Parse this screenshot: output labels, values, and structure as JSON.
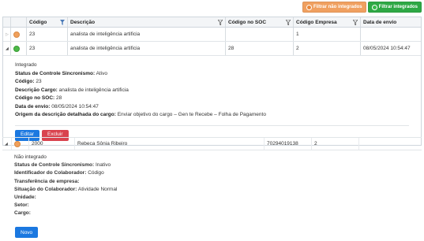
{
  "toolbar": {
    "filter_not_integrated": "Filtrar não integrados",
    "filter_integrated": "Filtrar integrados"
  },
  "grid": {
    "columns": [
      "Código",
      "Descrição",
      "Código no SOC",
      "Código Empresa",
      "Data de envio"
    ],
    "rows": [
      {
        "status": "orange",
        "codigo": "23",
        "descricao": "analista de inteligência artificia",
        "codigo_soc": "",
        "codigo_empresa": "1",
        "data_envio": ""
      },
      {
        "status": "green",
        "codigo": "23",
        "descricao": "analista de inteligência artificia",
        "codigo_soc": "28",
        "codigo_empresa": "2",
        "data_envio": "08/05/2024 10:54:47"
      }
    ]
  },
  "detail1": {
    "title": "Integrado",
    "lines": [
      {
        "label": "Status de Controle Sincronismo:",
        "value": "Ativo"
      },
      {
        "label": "Código:",
        "value": "23"
      },
      {
        "label": "Descrição Cargo:",
        "value": "analista de inteligência artificia"
      },
      {
        "label": "Código no SOC:",
        "value": "28"
      },
      {
        "label": "Data de envio:",
        "value": "08/05/2024 10:54:47"
      },
      {
        "label": "Origem da descrição detalhada do cargo:",
        "value": "Enviar objetivo do cargo – Gen te Recebe – Folha de Pagamento"
      }
    ],
    "edit_label": "Editar",
    "delete_label": "Excluir"
  },
  "row3": {
    "status": "orange",
    "codigo": "2000",
    "nome": "Rebeca Sônia Ribeiro",
    "cpf": "70294019138",
    "empresa": "2"
  },
  "detail2": {
    "title": "Não integrado",
    "lines": [
      {
        "label": "Status de Controle Sincronismo:",
        "value": "Inativo"
      },
      {
        "label": "Identificador do Colaborador:",
        "value": "Código"
      },
      {
        "label": "Transferência de empresa:",
        "value": ""
      },
      {
        "label": "Situação do Colaborador:",
        "value": "Atividade Normal"
      },
      {
        "label": "Unidade:",
        "value": ""
      },
      {
        "label": "Setor:",
        "value": ""
      },
      {
        "label": "Cargo:",
        "value": ""
      }
    ],
    "new_label": "Novo"
  },
  "colors": {
    "orange": "#f0a05c",
    "green": "#4cb948",
    "blue": "#1b78e0",
    "red": "#d9434e"
  }
}
